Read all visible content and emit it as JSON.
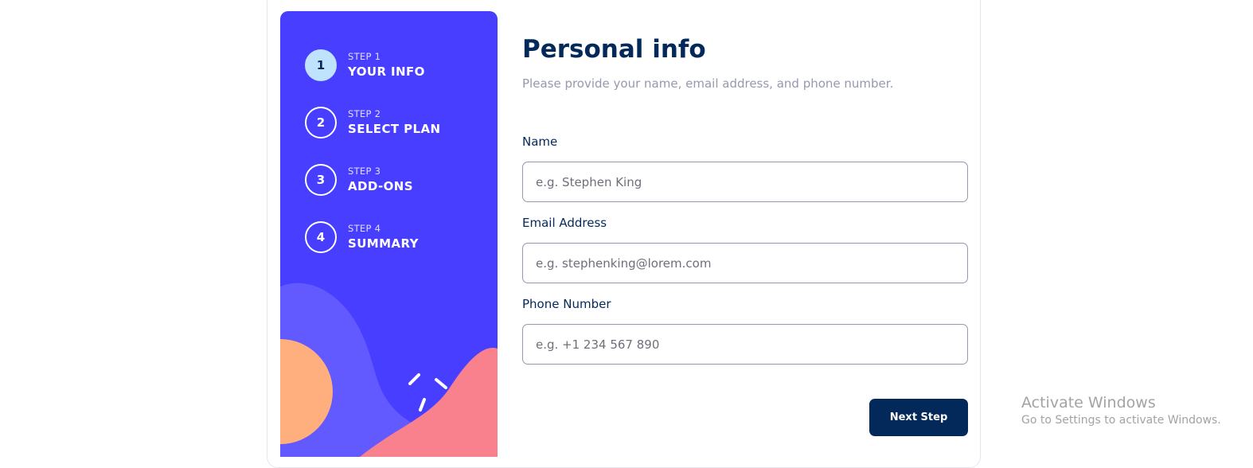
{
  "sidebar": {
    "steps": [
      {
        "number": "1",
        "label": "STEP 1",
        "title": "YOUR INFO",
        "active": true
      },
      {
        "number": "2",
        "label": "STEP 2",
        "title": "SELECT PLAN",
        "active": false
      },
      {
        "number": "3",
        "label": "STEP 3",
        "title": "ADD-ONS",
        "active": false
      },
      {
        "number": "4",
        "label": "STEP 4",
        "title": "SUMMARY",
        "active": false
      }
    ]
  },
  "form": {
    "title": "Personal info",
    "subtitle": "Please provide your name, email address, and phone number.",
    "fields": [
      {
        "label": "Name",
        "value": "",
        "placeholder": "e.g. Stephen King"
      },
      {
        "label": "Email Address",
        "value": "",
        "placeholder": "e.g. stephenking@lorem.com"
      },
      {
        "label": "Phone Number",
        "value": "",
        "placeholder": "e.g. +1 234 567 890"
      }
    ],
    "next_label": "Next Step"
  },
  "watermark": {
    "title": "Activate Windows",
    "subtitle": "Go to Settings to activate Windows."
  },
  "colors": {
    "sidebar_bg": "#483eff",
    "active_step": "#bfe2fd",
    "primary_text": "#02295a",
    "muted_text": "#9699ab",
    "decor_purple": "#6259ff",
    "decor_orange": "#ffaf7e",
    "decor_pink": "#f9818e"
  }
}
